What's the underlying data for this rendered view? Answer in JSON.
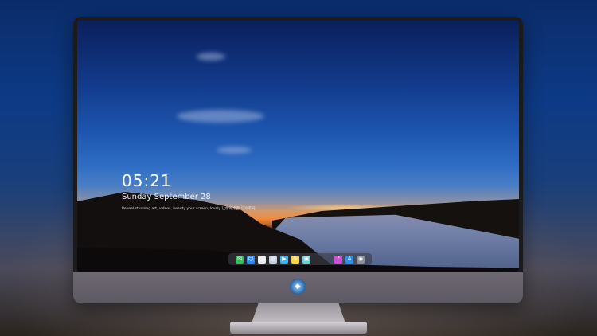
{
  "lock_screen": {
    "time": "05:21",
    "date": "Sunday September  28",
    "tagline": "Reveal stunning art, videos, beauty your screen, lovely 让你的桌面 与众不同"
  },
  "dock": {
    "icons": [
      {
        "name": "messages-icon",
        "glyph": "✉",
        "color": "#3dbb5a"
      },
      {
        "name": "finder-icon",
        "glyph": "☺",
        "color": "#2d8cf0"
      },
      {
        "name": "safari-icon",
        "glyph": "◎",
        "color": "#eaeaea"
      },
      {
        "name": "preview-icon",
        "glyph": "▤",
        "color": "#c8d3e0"
      },
      {
        "name": "video-icon",
        "glyph": "▶",
        "color": "#3fb3ea"
      },
      {
        "name": "notes-icon",
        "glyph": "✎",
        "color": "#f7d350"
      },
      {
        "name": "photos-icon",
        "glyph": "▣",
        "color": "#6ad0d4"
      },
      {
        "name": "music-icon",
        "glyph": "♪",
        "color": "#d04fd8"
      },
      {
        "name": "appstore-icon",
        "glyph": "A",
        "color": "#2f8cf0"
      },
      {
        "name": "camera-icon",
        "glyph": "◉",
        "color": "#8a8f99"
      }
    ]
  },
  "monitor": {
    "logo_glyph": "◆"
  },
  "colors": {
    "sky_top": "#0b1f5c",
    "horizon_orange": "#f08a3a",
    "bezel": "#1b1b1d",
    "chin": "#6d6872"
  }
}
